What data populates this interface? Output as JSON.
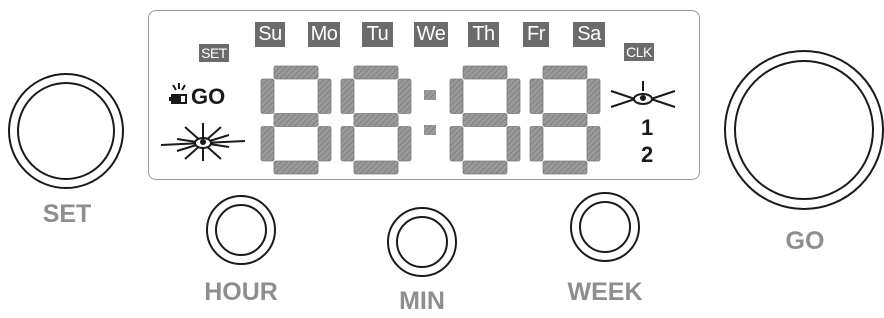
{
  "days": [
    "Su",
    "Mo",
    "Tu",
    "We",
    "Th",
    "Fr",
    "Sa"
  ],
  "lcd": {
    "set_tag": "SET",
    "clk_tag": "CLK",
    "go_text": "GO",
    "program_1": "1",
    "program_2": "2",
    "digits": [
      "8",
      "8",
      "8",
      "8"
    ],
    "segment_color": "#8c8c8c"
  },
  "buttons": {
    "set": "SET",
    "hour": "HOUR",
    "min": "MIN",
    "week": "WEEK",
    "go": "GO"
  },
  "icons": [
    "battery-icon",
    "sprinkler-left-icon",
    "sprinkler-right-icon"
  ],
  "colors": {
    "label": "#8e8e8e",
    "tag_bg": "#6b6b6b",
    "outline": "#1a1a1a"
  }
}
